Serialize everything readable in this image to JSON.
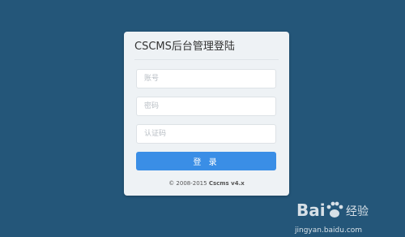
{
  "login": {
    "title": "CSCMS后台管理登陆",
    "account_placeholder": "账号",
    "password_placeholder": "密码",
    "captcha_placeholder": "认证码",
    "submit_label": "登 录",
    "footer_prefix": "© 2008-2015 ",
    "footer_brand": "Cscms v4.x"
  },
  "watermark": {
    "logo_text": "Bai 经验",
    "site": "jingyan.baidu.com"
  },
  "colors": {
    "background": "#245679",
    "card": "#eef2f5",
    "primary_button": "#3a8ee6"
  }
}
